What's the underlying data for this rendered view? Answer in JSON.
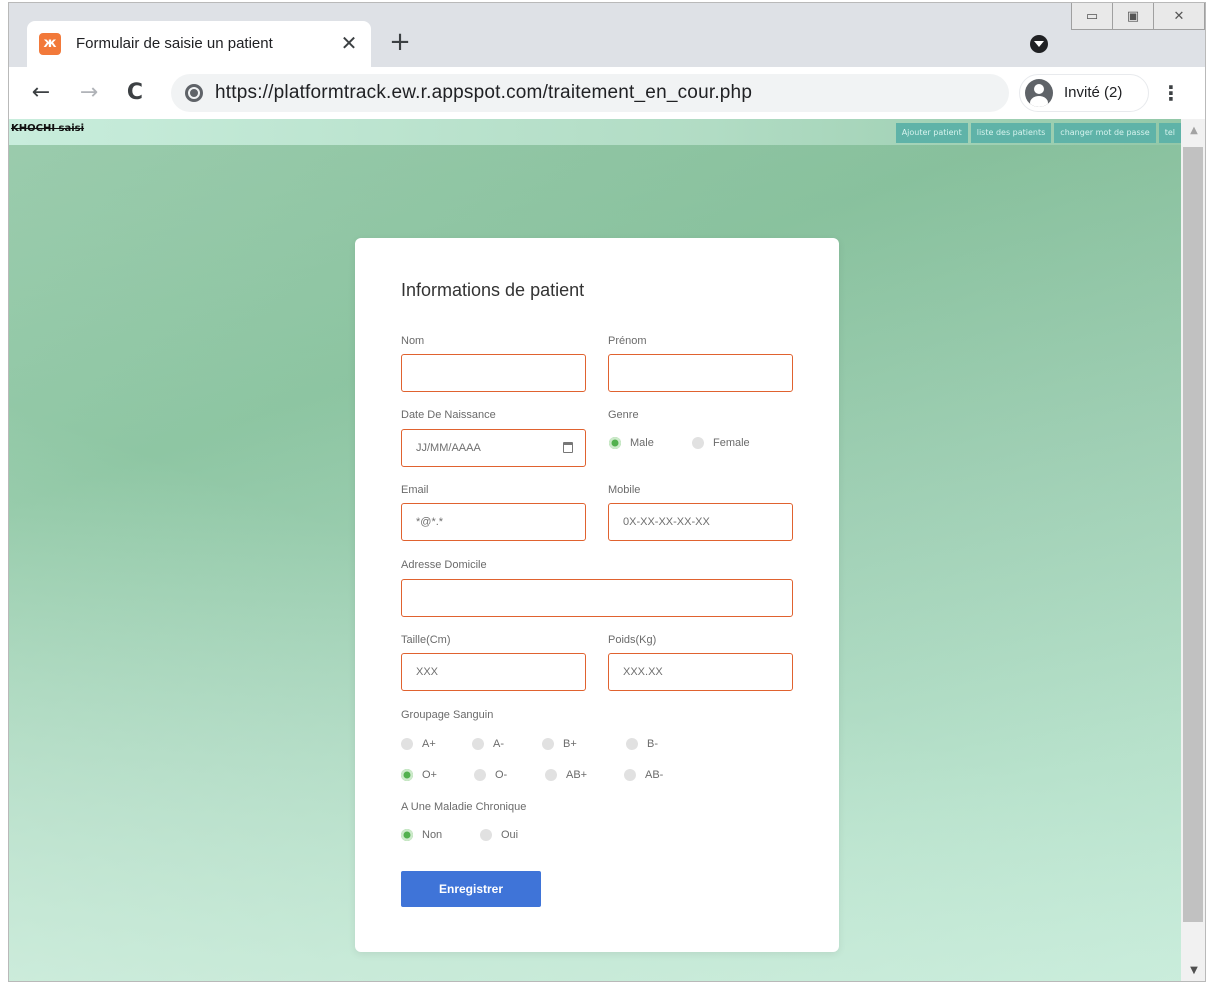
{
  "browser": {
    "tab_title": "Formulair de saisie un patient",
    "tab_close": "✕",
    "new_tab": "+",
    "url": "https://platformtrack.ew.r.appspot.com/traitement_en_cour.php",
    "profile_label": "Invité (2)",
    "back": "←",
    "forward": "→",
    "reload": "C",
    "menu": "⋮",
    "window_controls": {
      "minimize": "▭",
      "restore": "▣",
      "close": "✕"
    }
  },
  "site": {
    "logo_text": "KHOCHI saisi",
    "nav": [
      "Ajouter patient",
      "liste des patients",
      "changer mot de passe",
      "tel"
    ]
  },
  "form": {
    "title": "Informations de patient",
    "nom": {
      "label": "Nom",
      "value": "",
      "placeholder": ""
    },
    "prenom": {
      "label": "Prénom",
      "value": "",
      "placeholder": ""
    },
    "date_naissance": {
      "label": "Date De Naissance",
      "placeholder": "JJ/MM/AAAA"
    },
    "genre": {
      "label": "Genre",
      "options": [
        "Male",
        "Female"
      ],
      "selected": "Male"
    },
    "email": {
      "label": "Email",
      "placeholder": "*@*.*"
    },
    "mobile": {
      "label": "Mobile",
      "placeholder": "0X-XX-XX-XX-XX"
    },
    "adresse": {
      "label": "Adresse Domicile",
      "placeholder": ""
    },
    "taille": {
      "label": "Taille(Cm)",
      "placeholder": "XXX"
    },
    "poids": {
      "label": "Poids(Kg)",
      "placeholder": "XXX.XX"
    },
    "groupage": {
      "label": "Groupage Sanguin",
      "options": [
        "A+",
        "A-",
        "B+",
        "B-",
        "O+",
        "O-",
        "AB+",
        "AB-"
      ],
      "selected": "O+"
    },
    "maladie": {
      "label": "A Une Maladie Chronique",
      "options": [
        "Non",
        "Oui"
      ],
      "selected": "Non"
    },
    "submit_label": "Enregistrer"
  },
  "colors": {
    "accent_green": "#52b14f",
    "field_border": "#e0622f",
    "button_blue": "#3f74d8",
    "nav_teal": "#5fb3a8"
  }
}
